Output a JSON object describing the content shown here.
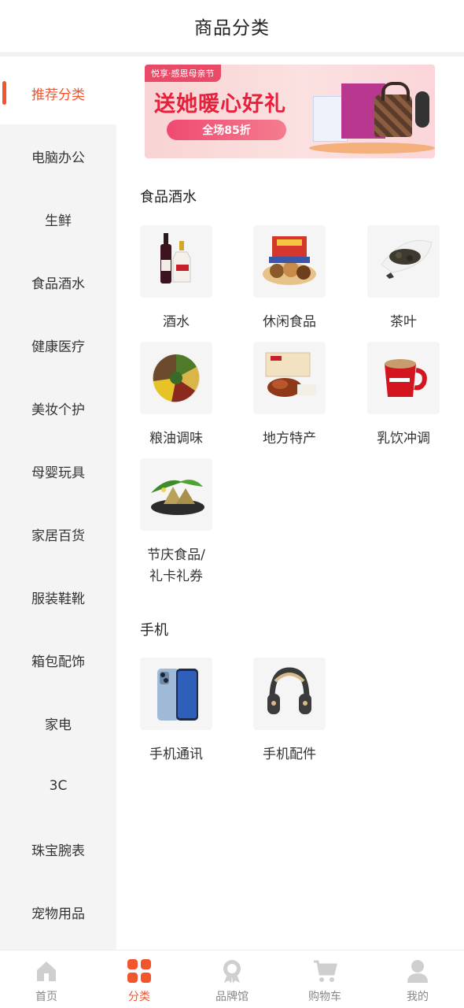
{
  "header": {
    "title": "商品分类"
  },
  "sidebar": {
    "items": [
      {
        "label": "推荐分类",
        "active": true
      },
      {
        "label": "电脑办公"
      },
      {
        "label": "生鲜"
      },
      {
        "label": "食品酒水"
      },
      {
        "label": "健康医疗"
      },
      {
        "label": "美妆个护"
      },
      {
        "label": "母婴玩具"
      },
      {
        "label": "家居百货"
      },
      {
        "label": "服装鞋靴"
      },
      {
        "label": "箱包配饰"
      },
      {
        "label": "家电"
      },
      {
        "label": "3C"
      },
      {
        "label": "珠宝腕表"
      },
      {
        "label": "宠物用品"
      }
    ]
  },
  "banner": {
    "tag": "悦享·感恩母亲节",
    "headline": "送她暖心好礼",
    "pill": "全场85折"
  },
  "sections": [
    {
      "title": "食品酒水",
      "items": [
        {
          "label": "酒水",
          "icon": "wine-bottles-icon"
        },
        {
          "label": "休闲食品",
          "icon": "snack-box-icon"
        },
        {
          "label": "茶叶",
          "icon": "tea-leaves-icon"
        },
        {
          "label": "粮油调味",
          "icon": "grains-plate-icon"
        },
        {
          "label": "地方特产",
          "icon": "roast-duck-icon"
        },
        {
          "label": "乳饮冲调",
          "icon": "coffee-mug-icon"
        },
        {
          "label_line1": "节庆食品/",
          "label_line2": "礼卡礼券",
          "icon": "zongzi-plate-icon"
        }
      ]
    },
    {
      "title": "手机",
      "items": [
        {
          "label": "手机通讯",
          "icon": "smartphone-icon"
        },
        {
          "label": "手机配件",
          "icon": "headphones-icon"
        }
      ]
    }
  ],
  "bottom_nav": [
    {
      "label": "首页",
      "icon": "home-icon"
    },
    {
      "label": "分类",
      "icon": "category-grid-icon",
      "active": true
    },
    {
      "label": "品牌馆",
      "icon": "award-badge-icon"
    },
    {
      "label": "购物车",
      "icon": "shopping-cart-icon"
    },
    {
      "label": "我的",
      "icon": "user-profile-icon"
    }
  ],
  "colors": {
    "accent": "#f2542d",
    "sidebar_bg": "#f4f4f4",
    "nav_inactive": "#cccccc"
  }
}
